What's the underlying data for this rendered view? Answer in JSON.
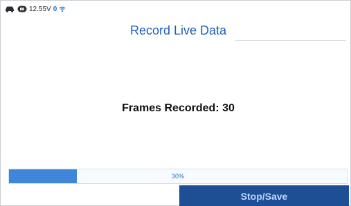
{
  "status": {
    "voltage": "12.55V",
    "count": "0",
    "icons": [
      "car-icon",
      "obd-icon",
      "wifi-icon"
    ]
  },
  "header": {
    "title": "Record Live Data"
  },
  "main": {
    "frames_label": "Frames Recorded: 30"
  },
  "progress": {
    "value": 0.2,
    "label": "30%"
  },
  "actions": {
    "stop_save_label": "Stop/Save"
  },
  "colors": {
    "accent": "#1e5fb8",
    "progress_fill": "#3f86d8",
    "button_bg": "#1e4e94"
  }
}
